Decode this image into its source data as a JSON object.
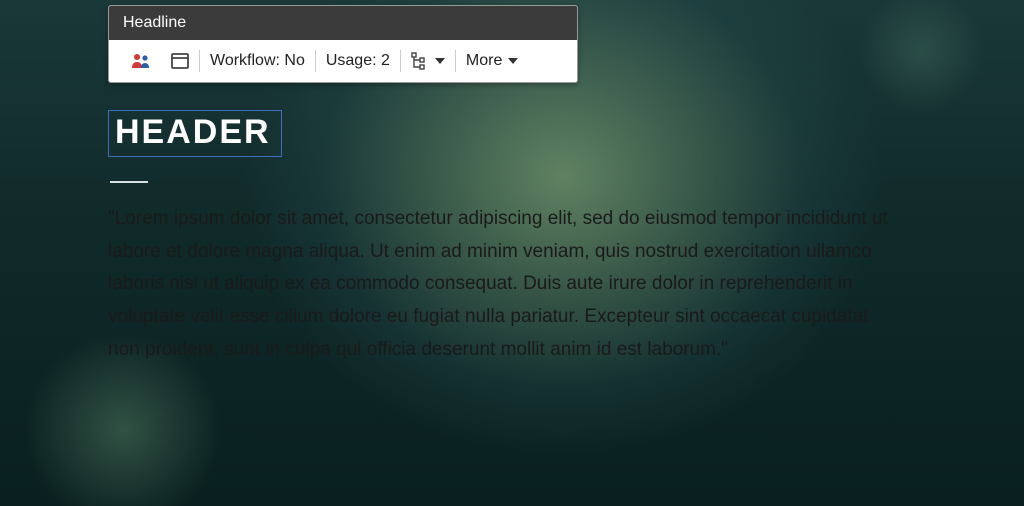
{
  "toolbox": {
    "title": "Headline",
    "workflow_label": "Workflow: No",
    "usage_label": "Usage: 2",
    "more_label": "More"
  },
  "content": {
    "header": "HEADER",
    "body": "\"Lorem ipsum dolor sit amet, consectetur adipiscing elit, sed do eiusmod tempor incididunt ut labore et dolore magna aliqua. Ut enim ad minim veniam, quis nostrud exercitation ullamco laboris nisi ut aliquip ex ea commodo consequat. Duis aute irure dolor in reprehenderit in voluptate velit esse cillum dolore eu fugiat nulla pariatur. Excepteur sint occaecat cupidatat non proident, sunt in culpa qui officia deserunt mollit anim id est laborum.\""
  }
}
